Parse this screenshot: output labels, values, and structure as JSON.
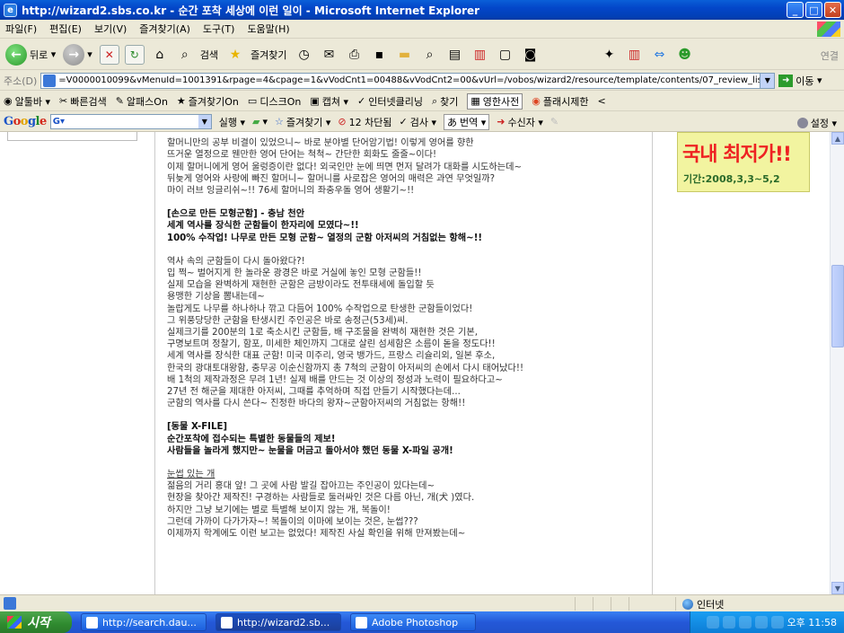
{
  "window": {
    "title": "http://wizard2.sbs.co.kr - 순간 포착 세상에 이런 일이 - Microsoft Internet Explorer",
    "min": "_",
    "max": "□",
    "close": "✕"
  },
  "menu": [
    "파일(F)",
    "편집(E)",
    "보기(V)",
    "즐겨찾기(A)",
    "도구(T)",
    "도움말(H)"
  ],
  "nav": {
    "back_label": "뒤로",
    "search_label": "검색",
    "favorites_label": "즐겨찾기",
    "right_label": "연결"
  },
  "address": {
    "label": "주소(D)",
    "url": "=V0000010099&vMenuId=1001391&rpage=4&cpage=1&vVodCnt1=00488&vVodCnt2=00&vUrl=/vobos/wizard2/resource/template/contents/07_review_list.jsp",
    "go_label": "이동"
  },
  "links": [
    {
      "icon": "◉",
      "label": "알툴바 ▾"
    },
    {
      "icon": "✂",
      "label": "빠른검색"
    },
    {
      "icon": "✎",
      "label": "알패스On"
    },
    {
      "icon": "★",
      "label": "즐겨찾기On"
    },
    {
      "icon": "▭",
      "label": "디스크On"
    },
    {
      "icon": "▣",
      "label": "캡쳐 ▾"
    },
    {
      "icon": "✓",
      "label": "인터넷클리닝"
    },
    {
      "icon": "⌕",
      "label": "찾기"
    },
    {
      "icon": "▦",
      "label": "영한사전"
    },
    {
      "icon": "◉",
      "label": "플래시제한"
    },
    {
      "icon": "",
      "label": "<"
    }
  ],
  "google": {
    "logo": "Google",
    "search_value": "G▾",
    "items": [
      {
        "icon": "",
        "label": "실행 ▾"
      },
      {
        "icon": "",
        "label": "▾"
      },
      {
        "icon": "☆",
        "label": "즐겨찾기 ▾"
      },
      {
        "icon": "⊘",
        "label": "12 차단됨"
      },
      {
        "icon": "✓",
        "label": "검사 ▾"
      },
      {
        "icon": "",
        "label": "번역 ▾"
      },
      {
        "icon": "➜",
        "label": "수신자 ▾"
      }
    ],
    "settings_label": "설정 ▾"
  },
  "article": {
    "lines_top": [
      "할머니만의 공부 비결이 있었으니~ 바로 분야별 단어암기법! 이렇게 영어를 향한",
      "뜨거운 열정으로 웬만한 영어 단어는 척척~ 간단한 회화도 줄줄~이다!",
      "이제 할머니에게 영어 울렁증이란 없다! 외국인만 눈에 띄면 먼저 달려가 대화를 시도하는데~",
      "뒤늦게 영어와 사랑에 빠진 할머니~ 할머니를 사로잡은 영어의 매력은 과연 무엇일까?",
      "마이 러브 잉글리쉬~!! 76세 할머니의 좌충우돌 영어 생활기~!!"
    ],
    "section2_title": "[손으로 만든 모형군함] - 충남 천안",
    "section2_sub1": "세계 역사를 장식한 군함들이 한자리에 모였다~!!",
    "section2_sub2": "100% 수작업! 나무로 만든 모형 군함~ 열정의 군함 아저씨의 거침없는 항해~!!",
    "section2_lines": [
      "역사 속의 군함들이 다시 돌아왔다?!",
      "입 쩍~ 벌어지게 한 놀라운 광경은 바로 거실에 놓인 모형 군함들!!",
      "실제 모습을 완벽하게 재현한 군함은 금방이라도 전투태세에 돌입할 듯",
      "용맹한 기상을 뽐내는데~",
      "놀랍게도 나무를 하나하나 깎고 다듬어 100% 수작업으로 탄생한 군함들이었다!",
      "그 위풍당당한 군함을 탄생시킨 주인공은 바로 송정근(53세)씨.",
      "실제크기를 200분의 1로 축소시킨 군함들, 배 구조물을 완벽히 재현한 것은 기본,",
      "구명보트며 정찰기, 함포, 미세한 체인까지 그대로 살린 섬세함은 소름이 돋을 정도다!!",
      "세계 역사를 장식한 대표 군함! 미국 미주리, 영국 뱅가드, 프랑스 리슐리외, 일본 후소,",
      "한국의 광대토대왕함, 충무공 이순신함까지 총 7척의 군함이 아저씨의 손에서 다시 태어났다!!",
      "배 1척의 제작과정은 무려 1년! 실제 배를 만드는 것 이상의 정성과 노력이 필요하다고~",
      "27년 전 해군을 제대한 아저씨, 그때를 추억하며 직접 만들기 시작했다는데...",
      "군함의 역사를 다시 쓴다~ 진정한 바다의 왕자~군함아저씨의 거침없는 항해!!"
    ],
    "section3_title": "[동물 X-FILE]",
    "section3_sub1": "순간포착에 접수되는 특별한 동물들의 제보!",
    "section3_sub2": "사람들을 놀라게 했지만~ 눈물을 머금고 돌아서야 했던 동물 X-파일 공개!",
    "section3_link": "눈썹 있는 개",
    "section3_lines": [
      "젊음의 거리 홍대 앞! 그 곳에 사람 발길 잡아끄는 주인공이 있다는데~",
      "현장을 찾아간 제작진! 구경하는 사람들로 둘러싸인 것은 다름 아닌, 개(犬 )였다.",
      "하지만 그냥 보기에는 별로 특별해 보이지 않는 개, 복돌이!",
      "그런데 가까이 다가가자~! 복돌이의 이마에 보이는 것은, 눈썹???",
      "이제까지 학계에도 이런 보고는 없었다! 제작진 사실 확인을 위해 만져봤는데~"
    ]
  },
  "ad": {
    "headline": "국내 최저가!!",
    "period": "기간:2008,3,3~5,2"
  },
  "status": {
    "zone_label": "인터넷"
  },
  "taskbar": {
    "start_label": "시작",
    "tasks": [
      {
        "label": "http://search.dau..."
      },
      {
        "label": "http://wizard2.sb..."
      },
      {
        "label": "Adobe Photoshop"
      }
    ],
    "clock": "오후 11:58"
  }
}
